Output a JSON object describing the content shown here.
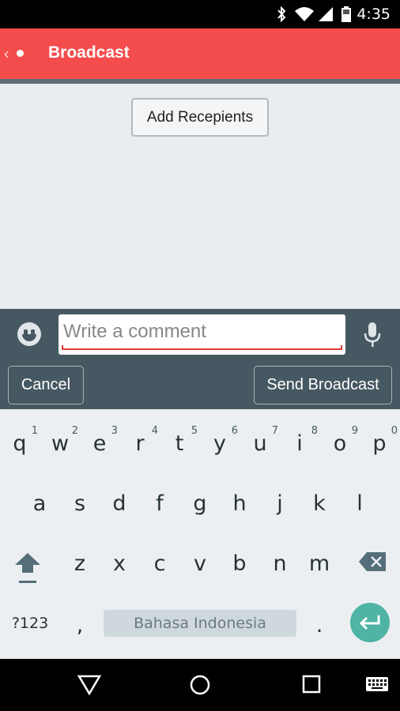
{
  "status_bar": {
    "time": "4:35",
    "icons": [
      "bluetooth-icon",
      "wifi-icon",
      "signal-icon",
      "battery-icon"
    ]
  },
  "action_bar": {
    "title": "Broadcast",
    "color": "#f44c4c"
  },
  "content": {
    "add_recipients_label": "Add Recepients"
  },
  "compose": {
    "comment_placeholder": "Write a comment",
    "comment_value": "",
    "cancel_label": "Cancel",
    "send_label": "Send Broadcast"
  },
  "keyboard": {
    "row1": [
      {
        "key": "q",
        "hint": "1"
      },
      {
        "key": "w",
        "hint": "2"
      },
      {
        "key": "e",
        "hint": "3"
      },
      {
        "key": "r",
        "hint": "4"
      },
      {
        "key": "t",
        "hint": "5"
      },
      {
        "key": "y",
        "hint": "6"
      },
      {
        "key": "u",
        "hint": "7"
      },
      {
        "key": "i",
        "hint": "8"
      },
      {
        "key": "o",
        "hint": "9"
      },
      {
        "key": "p",
        "hint": "0"
      }
    ],
    "row2": [
      "a",
      "s",
      "d",
      "f",
      "g",
      "h",
      "j",
      "k",
      "l"
    ],
    "row3": [
      "z",
      "x",
      "c",
      "v",
      "b",
      "n",
      "m"
    ],
    "symbols_label": "?123",
    "comma": ",",
    "space_label": "Bahasa Indonesia",
    "period": ".",
    "enter_color": "#4fb3a5"
  },
  "nav_bar": {
    "icons": [
      "back-triangle-icon",
      "home-circle-icon",
      "recents-square-icon",
      "keyboard-switch-icon"
    ]
  }
}
